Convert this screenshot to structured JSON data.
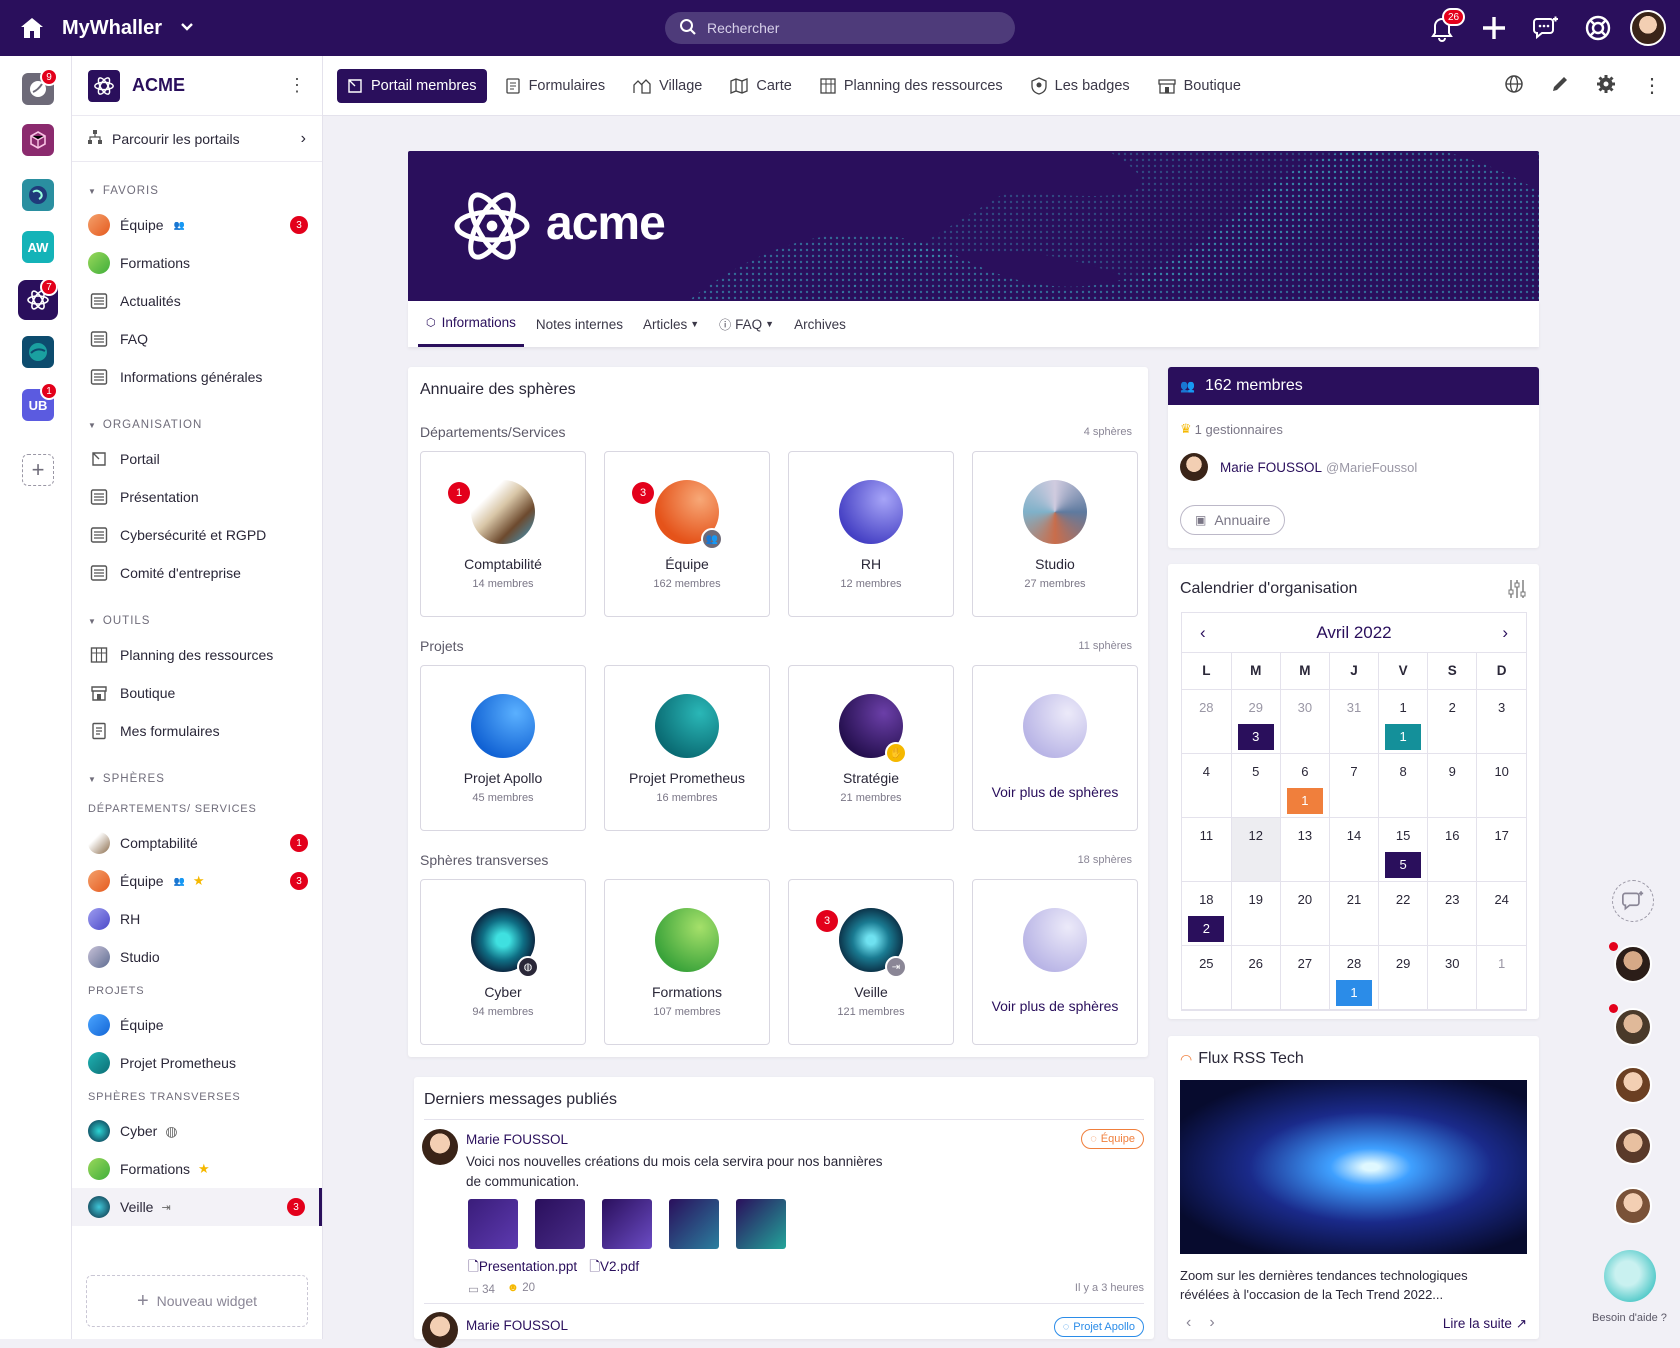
{
  "app": {
    "name": "MyWhaller",
    "search_placeholder": "Rechercher",
    "notif_count": "26"
  },
  "rail": {
    "badge_top": "9",
    "badge_acme": "7",
    "badge_ub": "1",
    "aw": "AW",
    "ub": "UB"
  },
  "sidebar": {
    "org": "ACME",
    "browse": "Parcourir les portails",
    "favoris_title": "FAVORIS",
    "favoris": [
      {
        "label": "Équipe",
        "badge": "3"
      },
      {
        "label": "Formations"
      },
      {
        "label": "Actualités"
      },
      {
        "label": "FAQ"
      },
      {
        "label": "Informations générales"
      }
    ],
    "organisation_title": "ORGANISATION",
    "organisation": [
      {
        "label": "Portail"
      },
      {
        "label": "Présentation"
      },
      {
        "label": "Cybersécurité et RGPD"
      },
      {
        "label": "Comité d'entreprise"
      }
    ],
    "outils_title": "OUTILS",
    "outils": [
      {
        "label": "Planning des ressources"
      },
      {
        "label": "Boutique"
      },
      {
        "label": "Mes formulaires"
      }
    ],
    "spheres_title": "SPHÈRES",
    "dep_title": "DÉPARTEMENTS/ SERVICES",
    "dep": [
      {
        "label": "Comptabilité",
        "badge": "1"
      },
      {
        "label": "Équipe",
        "badge": "3"
      },
      {
        "label": "RH"
      },
      {
        "label": "Studio"
      }
    ],
    "proj_title": "PROJETS",
    "proj": [
      {
        "label": "Équipe"
      },
      {
        "label": "Projet Prometheus"
      }
    ],
    "trans_title": "SPHÈRES TRANSVERSES",
    "trans": [
      {
        "label": "Cyber"
      },
      {
        "label": "Formations"
      },
      {
        "label": "Veille",
        "badge": "3"
      }
    ],
    "new_widget": "Nouveau widget"
  },
  "nav": {
    "tabs": [
      "Portail membres",
      "Formulaires",
      "Village",
      "Carte",
      "Planning des ressources",
      "Les badges",
      "Boutique"
    ]
  },
  "banner": {
    "logo_text": "acme",
    "tabs": [
      "Informations",
      "Notes internes",
      "Articles",
      "FAQ",
      "Archives"
    ]
  },
  "annuaire": {
    "title": "Annuaire des sphères",
    "groups": [
      {
        "title": "Départements/Services",
        "count": "4 sphères",
        "items": [
          {
            "name": "Comptabilité",
            "members": "14 membres",
            "badge": "1"
          },
          {
            "name": "Équipe",
            "members": "162 membres",
            "badge": "3"
          },
          {
            "name": "RH",
            "members": "12 membres"
          },
          {
            "name": "Studio",
            "members": "27 membres"
          }
        ]
      },
      {
        "title": "Projets",
        "count": "11 sphères",
        "items": [
          {
            "name": "Projet Apollo",
            "members": "45 membres"
          },
          {
            "name": "Projet Prometheus",
            "members": "16 membres"
          },
          {
            "name": "Stratégie",
            "members": "21 membres"
          }
        ],
        "more": "Voir plus de sphères"
      },
      {
        "title": "Sphères transverses",
        "count": "18 sphères",
        "items": [
          {
            "name": "Cyber",
            "members": "94 membres"
          },
          {
            "name": "Formations",
            "members": "107 membres"
          },
          {
            "name": "Veille",
            "members": "121 membres",
            "badge": "3"
          }
        ],
        "more": "Voir plus de sphères"
      }
    ]
  },
  "members": {
    "title": "162 membres",
    "managers": "1 gestionnaires",
    "manager_name": "Marie FOUSSOL",
    "manager_handle": "@MarieFoussol",
    "annuaire_btn": "Annuaire"
  },
  "calendar": {
    "title": "Calendrier d'organisation",
    "month": "Avril 2022",
    "days": [
      "L",
      "M",
      "M",
      "J",
      "V",
      "S",
      "D"
    ],
    "weeks": [
      [
        "28",
        "29",
        "30",
        "31",
        "1",
        "2",
        "3"
      ],
      [
        "4",
        "5",
        "6",
        "7",
        "8",
        "9",
        "10"
      ],
      [
        "11",
        "12",
        "13",
        "14",
        "15",
        "16",
        "17"
      ],
      [
        "18",
        "19",
        "20",
        "21",
        "22",
        "23",
        "24"
      ],
      [
        "25",
        "26",
        "27",
        "28",
        "29",
        "30",
        "1"
      ]
    ],
    "events": [
      {
        "w": 0,
        "d": 1,
        "n": "3",
        "color": "#2a0f5c"
      },
      {
        "w": 0,
        "d": 4,
        "n": "1",
        "color": "#14909a"
      },
      {
        "w": 1,
        "d": 2,
        "n": "1",
        "color": "#f07f3c"
      },
      {
        "w": 2,
        "d": 4,
        "n": "5",
        "color": "#2a0f5c"
      },
      {
        "w": 3,
        "d": 0,
        "n": "2",
        "color": "#2a0f5c"
      },
      {
        "w": 4,
        "d": 3,
        "n": "1",
        "color": "#2b8ce8"
      }
    ]
  },
  "messages": {
    "title": "Derniers messages publiés",
    "items": [
      {
        "author": "Marie FOUSSOL",
        "tag": "Équipe",
        "text1": "Voici nos nouvelles créations du mois cela servira pour nos bannières",
        "text2": "de communication.",
        "file1": "Presentation.ppt",
        "file2": "V2.pdf",
        "comments": "34",
        "likes": "20",
        "time": "Il y a 3 heures"
      },
      {
        "author": "Marie FOUSSOL",
        "tag": "Projet Apollo"
      }
    ]
  },
  "rss": {
    "title": "Flux RSS Tech",
    "text": "Zoom sur les dernières tendances technologiques révélées à l'occasion de la Tech Trend 2022...",
    "more": "Lire la suite"
  },
  "help": {
    "label": "Besoin d'aide ?"
  }
}
